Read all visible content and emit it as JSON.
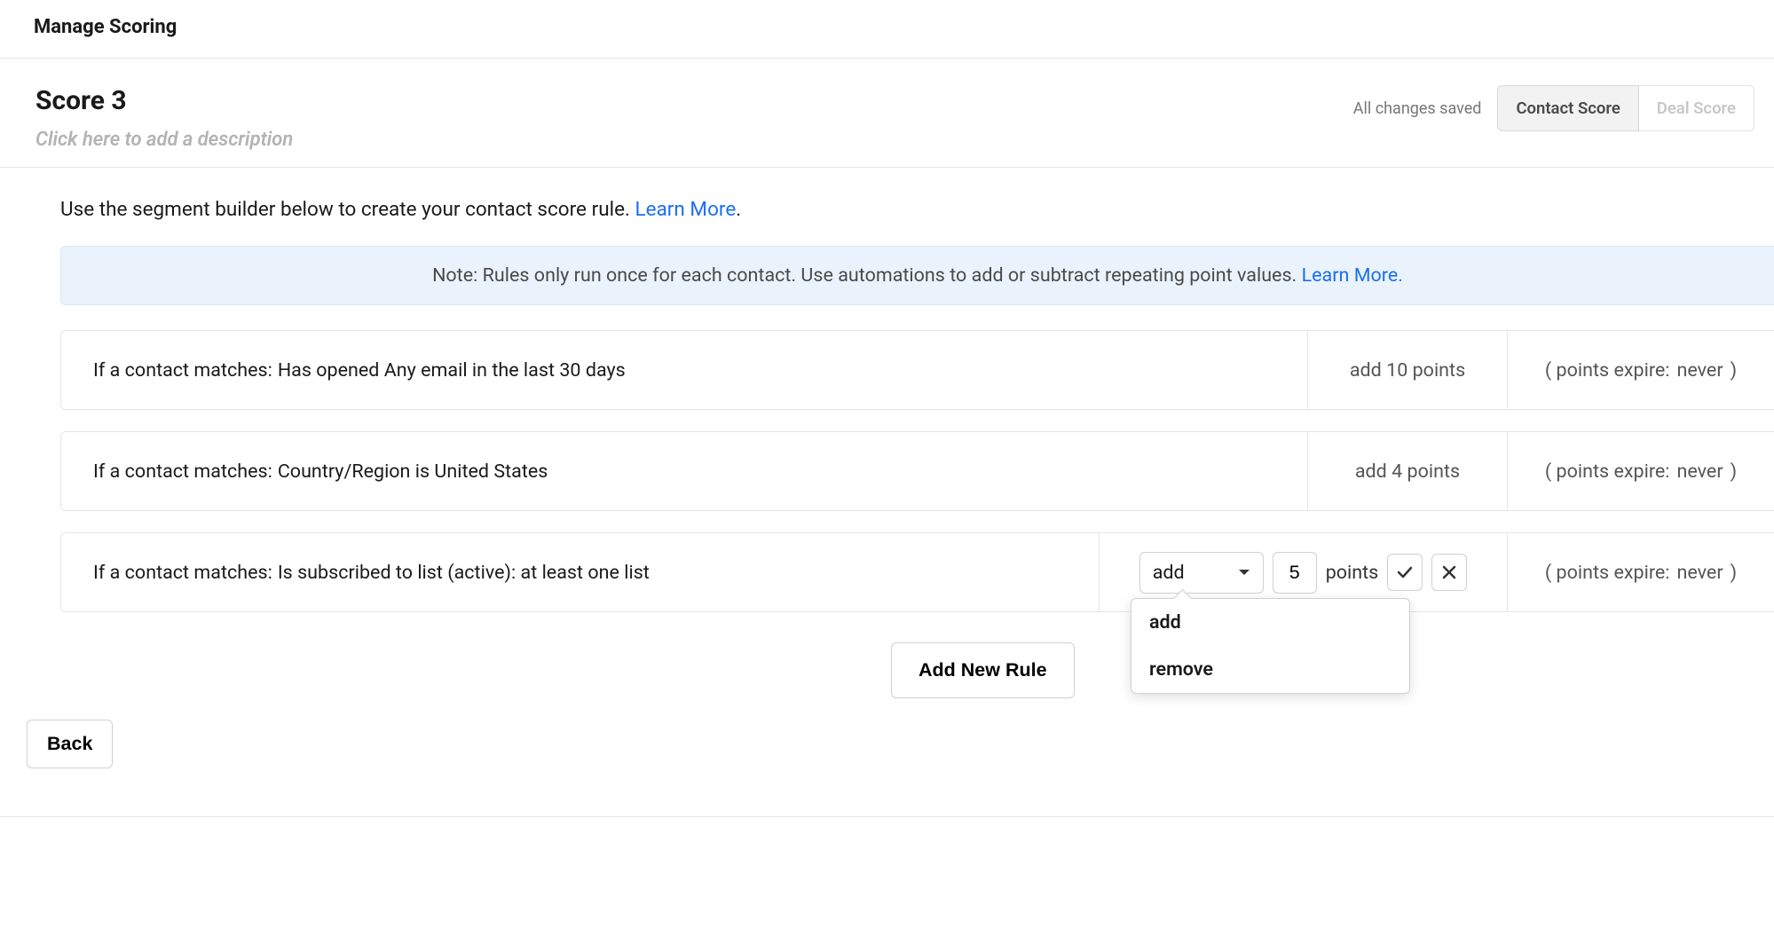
{
  "topbar": {
    "title": "Manage Scoring"
  },
  "header": {
    "score_name": "Score 3",
    "description_placeholder": "Click here to add a description",
    "saved_label": "All changes saved",
    "tabs": {
      "contact": "Contact Score",
      "deal": "Deal Score"
    }
  },
  "intro": {
    "text_before": "Use the segment builder below to create your contact score rule. ",
    "learn_more": "Learn More",
    "period": "."
  },
  "note": {
    "text_before": "Note: Rules only run once for each contact. Use automations to add or subtract repeating point values. ",
    "learn_more": "Learn More."
  },
  "rule_prefix": "If a contact matches:",
  "expire_prefix": "( points expire:",
  "expire_suffix": ")",
  "rules": [
    {
      "condition": "Has opened Any email in the last 30 days",
      "points_text": "add 10 points",
      "expire_value": "never"
    },
    {
      "condition": "Country/Region is United States",
      "points_text": "add 4 points",
      "expire_value": "never"
    },
    {
      "condition": "Is subscribed to list (active): at least one list",
      "op_value": "add",
      "num_value": "5",
      "points_label": "points",
      "expire_value": "never"
    }
  ],
  "dropdown_menu": {
    "opt_add": "add",
    "opt_remove": "remove"
  },
  "buttons": {
    "add_new_rule": "Add New Rule",
    "back": "Back"
  }
}
